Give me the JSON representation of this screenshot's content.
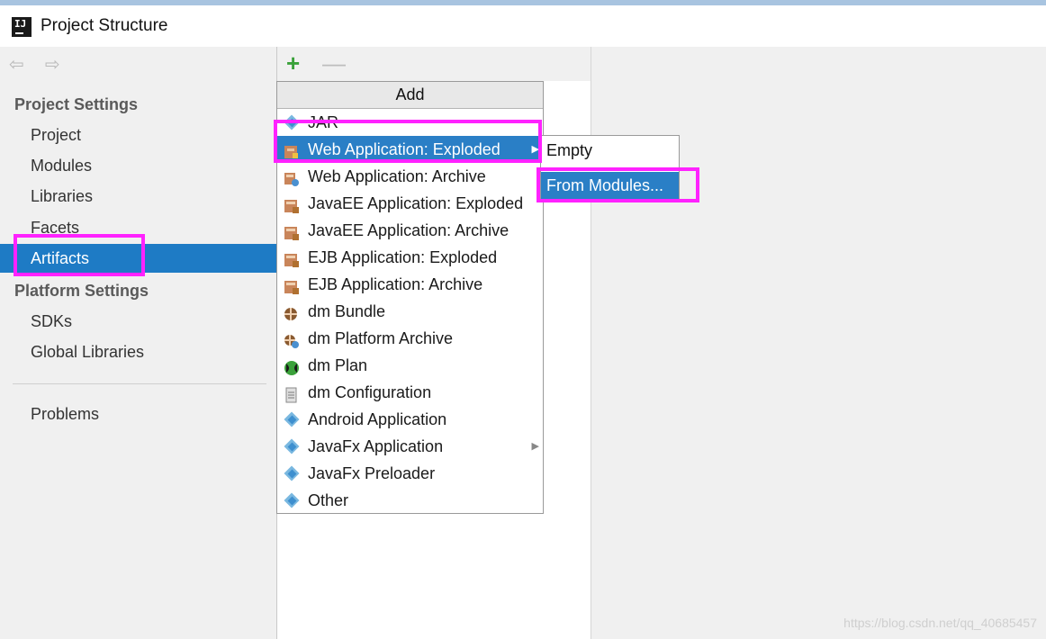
{
  "window": {
    "title": "Project Structure",
    "icon": "intellij-icon",
    "icon_text": "IJ"
  },
  "sidebar": {
    "back_icon": "⇦",
    "forward_icon": "⇨",
    "sections": [
      {
        "label": "Project Settings",
        "items": [
          "Project",
          "Modules",
          "Libraries",
          "Facets",
          "Artifacts"
        ]
      },
      {
        "label": "Platform Settings",
        "items": [
          "SDKs",
          "Global Libraries"
        ]
      }
    ],
    "problems": "Problems",
    "selected": "Artifacts"
  },
  "toolbar": {
    "add_icon": "+",
    "remove_icon": "—"
  },
  "add_menu": {
    "title": "Add",
    "items": [
      {
        "label": "JAR",
        "icon": "jar-icon"
      },
      {
        "label": "Web Application: Exploded",
        "icon": "web-app-icon",
        "submenu": true,
        "highlighted": true
      },
      {
        "label": "Web Application: Archive",
        "icon": "web-archive-icon"
      },
      {
        "label": "JavaEE Application: Exploded",
        "icon": "javaee-icon"
      },
      {
        "label": "JavaEE Application: Archive",
        "icon": "javaee-archive-icon"
      },
      {
        "label": "EJB Application: Exploded",
        "icon": "ejb-icon"
      },
      {
        "label": "EJB Application: Archive",
        "icon": "ejb-archive-icon"
      },
      {
        "label": "dm Bundle",
        "icon": "dm-bundle-icon"
      },
      {
        "label": "dm Platform Archive",
        "icon": "dm-platform-icon"
      },
      {
        "label": "dm Plan",
        "icon": "dm-plan-icon"
      },
      {
        "label": "dm Configuration",
        "icon": "dm-config-icon"
      },
      {
        "label": "Android Application",
        "icon": "android-icon"
      },
      {
        "label": "JavaFx Application",
        "icon": "javafx-icon",
        "submenu": true
      },
      {
        "label": "JavaFx Preloader",
        "icon": "javafx-preloader-icon"
      },
      {
        "label": "Other",
        "icon": "other-icon"
      }
    ]
  },
  "submenu": {
    "items": [
      {
        "label": "Empty"
      },
      {
        "label": "From Modules...",
        "highlighted": true
      }
    ]
  },
  "watermark": "https://blog.csdn.net/qq_40685457",
  "colors": {
    "selection": "#1e7bc5",
    "highlight_box": "#ff22ff",
    "add_icon": "#3aa13a"
  }
}
